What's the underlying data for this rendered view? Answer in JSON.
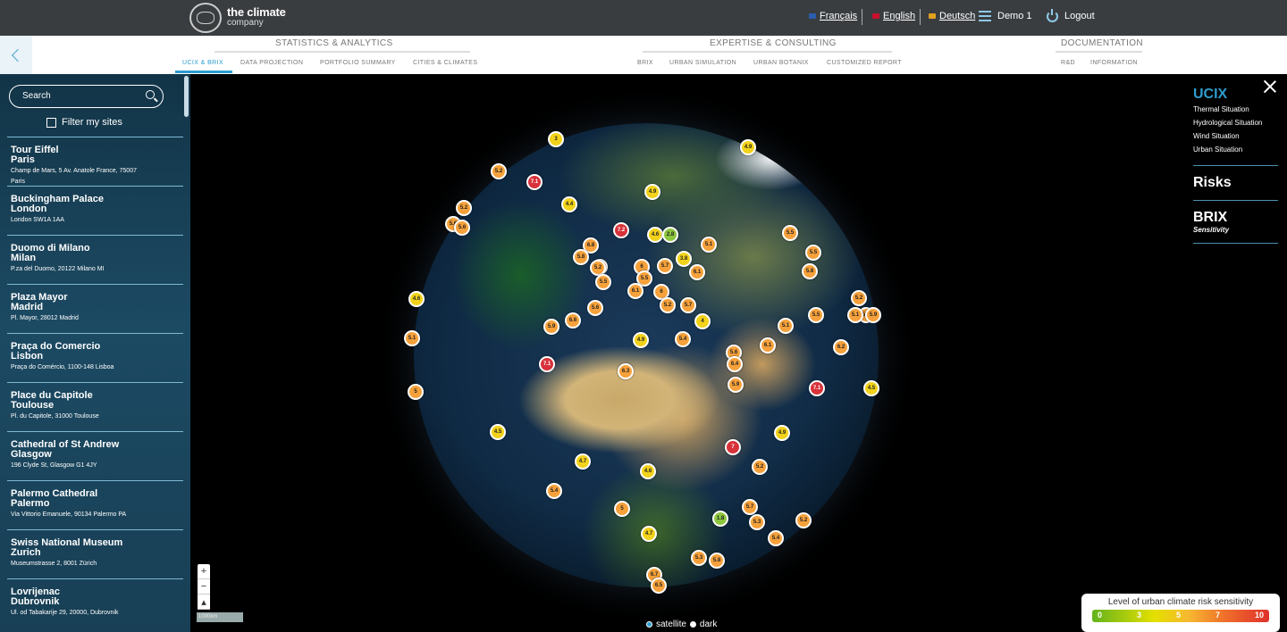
{
  "header": {
    "logo_line1": "the climate",
    "logo_line2": "company",
    "languages": [
      {
        "label": "Français",
        "flag_color": "#2a5db0"
      },
      {
        "label": "English",
        "flag_color": "#c8102e"
      },
      {
        "label": "Deutsch",
        "flag_color": "#e0a020"
      }
    ],
    "user": "Demo 1",
    "logout": "Logout"
  },
  "nav": {
    "groups": [
      {
        "title": "STATISTICS & ANALYTICS",
        "items": [
          "UCIX & BRIX",
          "DATA PROJECTION",
          "PORTFOLIO SUMMARY",
          "CITIES & CLIMATES"
        ]
      },
      {
        "title": "EXPERTISE & CONSULTING",
        "items": [
          "BRIX",
          "URBAN SIMULATION",
          "URBAN BOTANIX",
          "CUSTOMIZED REPORT"
        ]
      },
      {
        "title": "DOCUMENTATION",
        "items": [
          "R&D",
          "INFORMATION"
        ]
      }
    ],
    "active": "UCIX & BRIX"
  },
  "sidebar": {
    "search_label": "Search",
    "filter_label": "Filter my sites",
    "sites": [
      {
        "name": "Tour Eiffel",
        "city": "Paris",
        "address": "Champ de Mars, 5 Av. Anatole France, 75007",
        "address2": "Paris"
      },
      {
        "name": "Buckingham Palace",
        "city": "London",
        "address": "London SW1A 1AA",
        "address2": ""
      },
      {
        "name": "Duomo di Milano",
        "city": "Milan",
        "address": "P.za del Duomo, 20122 Milano MI",
        "address2": ""
      },
      {
        "name": "Plaza Mayor",
        "city": "Madrid",
        "address": "Pl. Mayor, 28012 Madrid",
        "address2": ""
      },
      {
        "name": "Praça do Comercio",
        "city": "Lisbon",
        "address": "Praça do Comércio, 1100-148 Lisboa",
        "address2": ""
      },
      {
        "name": "Place du Capitole",
        "city": "Toulouse",
        "address": "Pl. du Capitole, 31000 Toulouse",
        "address2": ""
      },
      {
        "name": "Cathedral of St Andrew",
        "city": "Glasgow",
        "address": "196 Clyde St, Glasgow G1 4JY",
        "address2": ""
      },
      {
        "name": "Palermo Cathedral",
        "city": "Palermo",
        "address": "Via Vittorio Emanuele, 90134 Palermo PA",
        "address2": ""
      },
      {
        "name": "Swiss National Museum",
        "city": "Zurich",
        "address": "Museumstrasse 2, 8001 Zürich",
        "address2": ""
      },
      {
        "name": "Lovrijenac",
        "city": "Dubrovnik",
        "address": "Ul. od Tabakarije 29, 20000, Dubrovnik",
        "address2": ""
      }
    ]
  },
  "map": {
    "scale": "1000km",
    "basemaps": [
      {
        "label": "satellite",
        "selected": true
      },
      {
        "label": "dark",
        "selected": false
      }
    ],
    "markers": [
      "3",
      "4.9",
      "5.2",
      "7.1",
      "4.9",
      "4.4",
      "5.2",
      "5.6",
      "5.6",
      "7.2",
      "4.6",
      "2.8",
      "5.1",
      "5.5",
      "6.8",
      "5.8",
      "6.1",
      "3.8",
      "5.2",
      "6",
      "5.7",
      "5.8",
      "5.5",
      "5.2",
      "5.5",
      "6",
      "5.5",
      "6.1",
      "5.2",
      "5.7",
      "4",
      "5.6",
      "6.6",
      "5.9",
      "4.9",
      "5.4",
      "5.6",
      "6.4",
      "7.1",
      "6.3",
      "5.9",
      "6.1",
      "6.2",
      "5.1",
      "5.2",
      "5.6",
      "5.9",
      "4.6",
      "5.1",
      "5",
      "4.9",
      "4.5",
      "4.7",
      "4.6",
      "5.2",
      "5.4",
      "7",
      "5",
      "5.7",
      "5.3",
      "1.8",
      "5.4",
      "5.2",
      "5.8",
      "4.7",
      "5.3",
      "6.7",
      "6.5",
      "5.5",
      "7.1",
      "5.1",
      "4.5"
    ]
  },
  "panel": {
    "ucix": "UCIX",
    "ucix_items": [
      "Thermal Situation",
      "Hydrological Situation",
      "Wind Situation",
      "Urban Situation"
    ],
    "risks": "Risks",
    "brix": "BRIX",
    "brix_sub": "Sensitivity"
  },
  "legend": {
    "title": "Level of urban climate risk sensitivity",
    "labels": [
      "0",
      "3",
      "5",
      "7",
      "10"
    ]
  },
  "colors": {
    "accent": "#2d9ccf",
    "topbar": "#3a3d40",
    "sidebar": "#183f55"
  }
}
